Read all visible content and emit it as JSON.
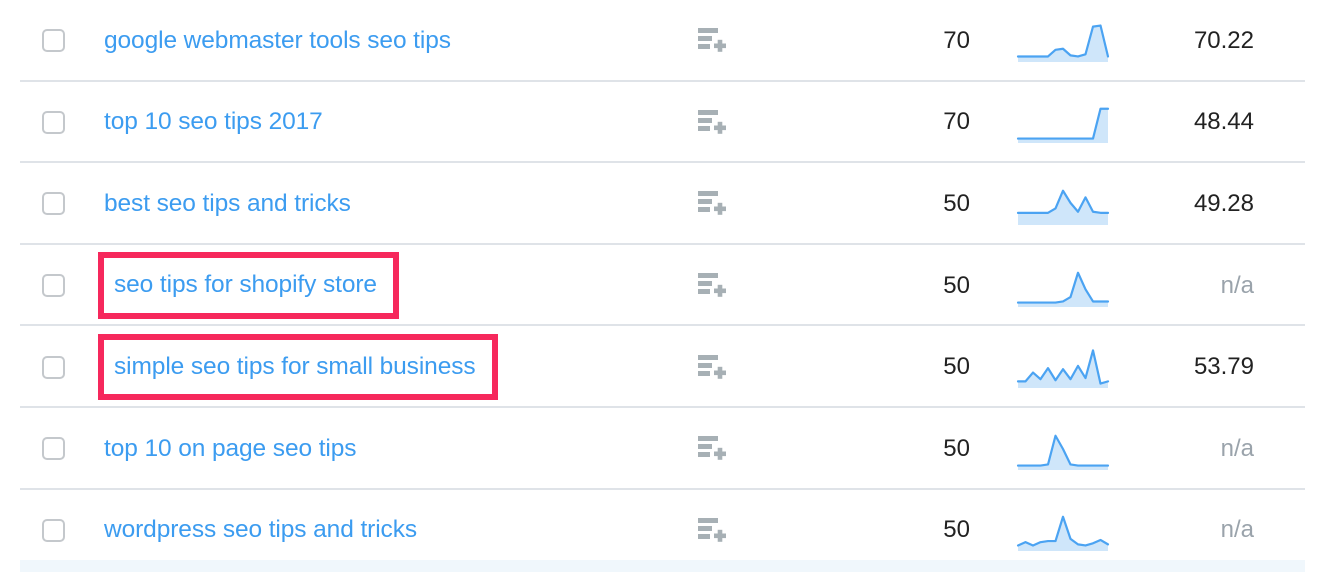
{
  "table": {
    "columns": [
      "select",
      "keyword",
      "add-to-list",
      "volume",
      "trend",
      "keyword-difficulty"
    ],
    "link_color": "#3c9cf0",
    "highlight_color": "#f6285c",
    "divider_color": "#dfe3e8",
    "spark_line_color": "#4ba3f2",
    "spark_fill_color": "#cfe6fa",
    "na_text_color": "#9aa3ab",
    "selected_row_color": "#f0f7fc",
    "rows": [
      {
        "keyword": "google webmaster tools seo tips",
        "volume": "70",
        "kd": "70.22",
        "kd_is_na": false,
        "highlighted": false,
        "add_icon": "add-to-list-icon",
        "trend": [
          10,
          10,
          10,
          10,
          10,
          22,
          24,
          12,
          10,
          14,
          64,
          66,
          10
        ]
      },
      {
        "keyword": "top 10 seo tips 2017",
        "volume": "70",
        "kd": "48.44",
        "kd_is_na": false,
        "highlighted": false,
        "add_icon": "add-to-list-icon",
        "trend": [
          8,
          8,
          8,
          8,
          8,
          8,
          8,
          8,
          8,
          8,
          8,
          62,
          62
        ]
      },
      {
        "keyword": "best seo tips and tricks",
        "volume": "50",
        "kd": "49.28",
        "kd_is_na": false,
        "highlighted": false,
        "add_icon": "add-to-list-icon",
        "trend": [
          22,
          22,
          22,
          22,
          22,
          30,
          62,
          40,
          24,
          50,
          24,
          22,
          22
        ]
      },
      {
        "keyword": "seo tips for shopify store",
        "volume": "50",
        "kd": "n/a",
        "kd_is_na": true,
        "highlighted": true,
        "add_icon": "add-to-list-icon",
        "trend": [
          8,
          8,
          8,
          8,
          8,
          8,
          10,
          18,
          62,
          32,
          10,
          10,
          10
        ]
      },
      {
        "keyword": "simple seo tips for small business",
        "volume": "50",
        "kd": "53.79",
        "kd_is_na": false,
        "highlighted": true,
        "add_icon": "add-to-list-icon",
        "trend": [
          12,
          12,
          28,
          16,
          36,
          14,
          34,
          16,
          40,
          18,
          68,
          8,
          12
        ]
      },
      {
        "keyword": "top 10 on page seo tips",
        "volume": "50",
        "kd": "n/a",
        "kd_is_na": true,
        "highlighted": false,
        "add_icon": "add-to-list-icon",
        "trend": [
          8,
          8,
          8,
          8,
          10,
          62,
          38,
          10,
          8,
          8,
          8,
          8,
          8
        ]
      },
      {
        "keyword": "wordpress seo tips and tricks",
        "volume": "50",
        "kd": "n/a",
        "kd_is_na": true,
        "highlighted": false,
        "add_icon": "add-to-list-icon",
        "trend": [
          10,
          16,
          10,
          16,
          18,
          18,
          62,
          22,
          12,
          10,
          14,
          20,
          12
        ]
      }
    ]
  }
}
